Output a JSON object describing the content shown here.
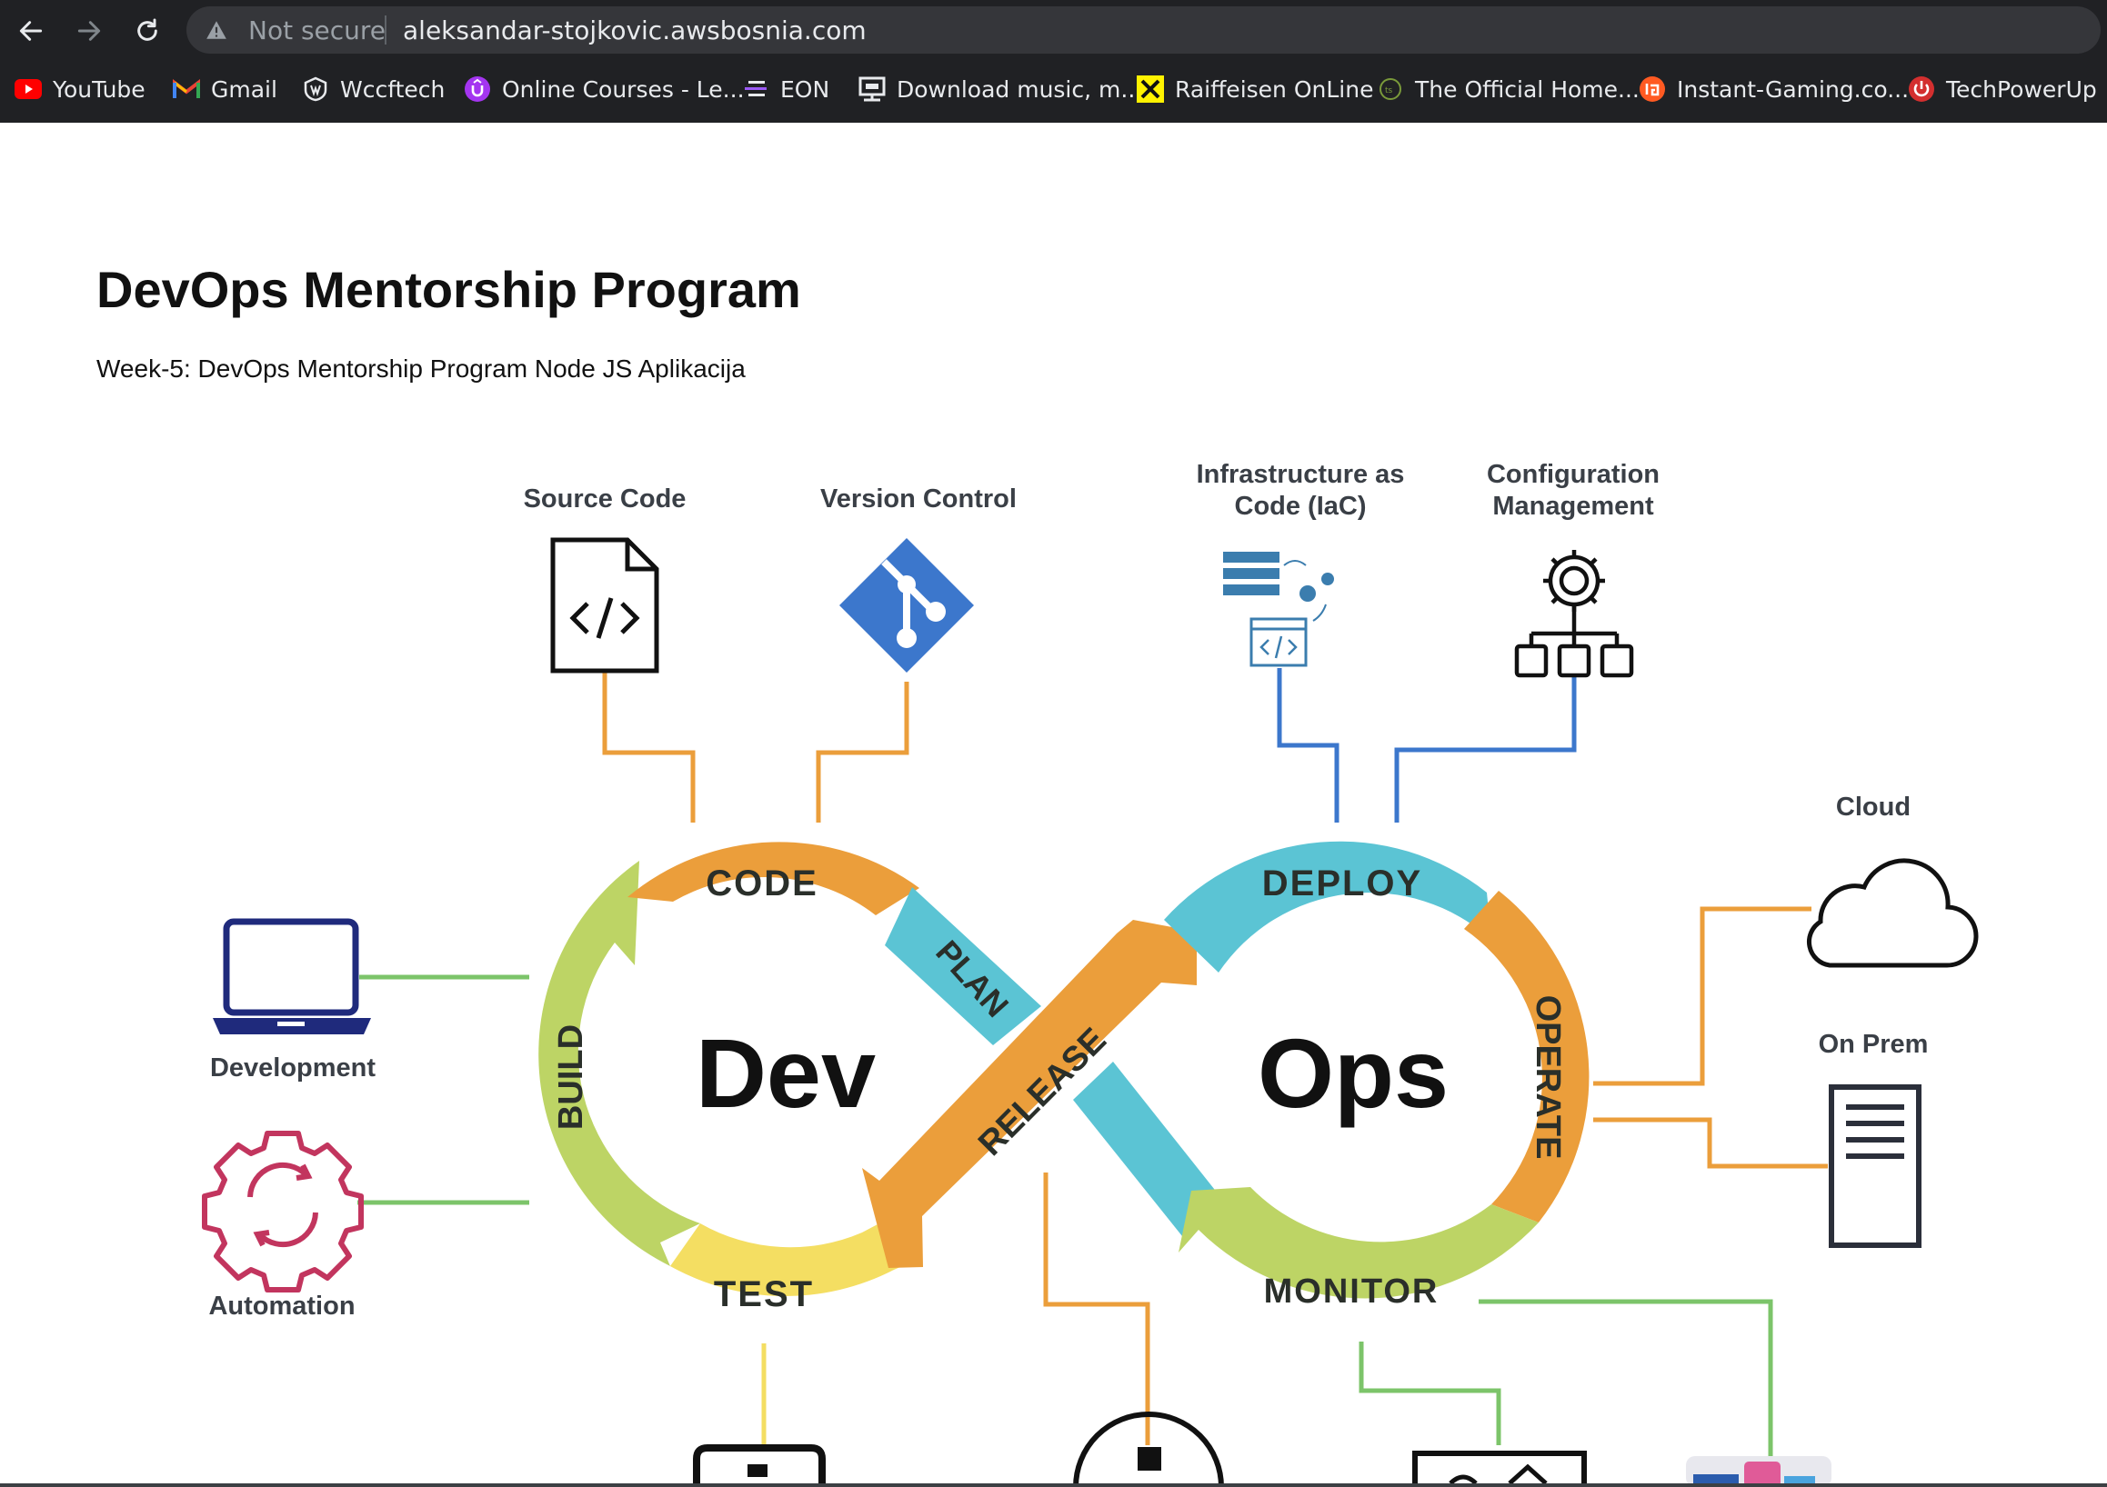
{
  "browser": {
    "security_label": "Not secure",
    "url": "aleksandar-stojkovic.awsbosnia.com",
    "bookmarks": [
      {
        "label": "YouTube",
        "icon": "youtube-icon"
      },
      {
        "label": "Gmail",
        "icon": "gmail-icon"
      },
      {
        "label": "Wccftech",
        "icon": "wccftech-icon"
      },
      {
        "label": "Online Courses - Le...",
        "icon": "udemy-icon"
      },
      {
        "label": "EON",
        "icon": "eon-icon"
      },
      {
        "label": "Download music, m...",
        "icon": "download-icon"
      },
      {
        "label": "Raiffeisen OnLine",
        "icon": "raiffeisen-icon"
      },
      {
        "label": "The Official Home...",
        "icon": "official-home-icon"
      },
      {
        "label": "Instant-Gaming.co...",
        "icon": "instant-gaming-icon"
      },
      {
        "label": "TechPowerUp",
        "icon": "techpowerup-icon"
      }
    ]
  },
  "page": {
    "title": "DevOps Mentorship Program",
    "subtitle": "Week-5: DevOps Mentorship Program Node JS Aplikacija"
  },
  "diagram": {
    "center_dev": "Dev",
    "center_ops": "Ops",
    "stages": {
      "code": "CODE",
      "plan": "PLAN",
      "build": "BUILD",
      "test": "TEST",
      "release": "RELEASE",
      "deploy": "DEPLOY",
      "operate": "OPERATE",
      "monitor": "MONITOR"
    },
    "labels": {
      "source_code": "Source Code",
      "version_control": "Version Control",
      "iac_line1": "Infrastructure as",
      "iac_line2": "Code (IaC)",
      "config_line1": "Configuration",
      "config_line2": "Management",
      "cloud": "Cloud",
      "on_prem": "On Prem",
      "development": "Development",
      "automation": "Automation"
    },
    "colors": {
      "orange": "#EB9E3B",
      "blue": "#5BC4D4",
      "green": "#BDD465",
      "yellow": "#F4DE62",
      "navy": "#1F2A7C",
      "git_blue": "#3C77CC",
      "automation_pink": "#C2355E"
    }
  }
}
